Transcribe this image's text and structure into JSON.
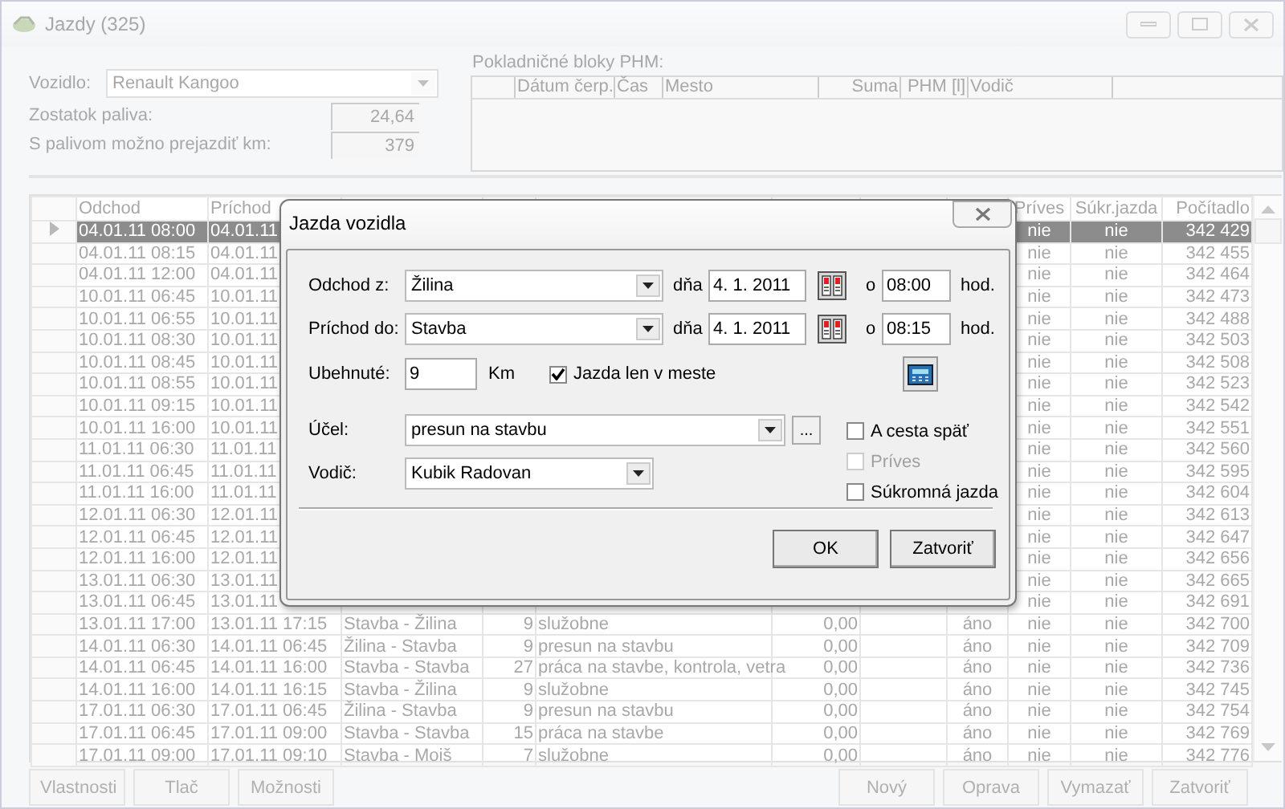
{
  "window": {
    "title": "Jazdy (325)",
    "disabled": true
  },
  "vehicle": {
    "label": "Vozidlo:",
    "value": "Renault Kangoo"
  },
  "fuel_left": {
    "label": "Zostatok paliva:",
    "value": "24,64"
  },
  "range": {
    "label": "S palivom možno prejazdiť km:",
    "value": "379"
  },
  "receipts": {
    "label": "Pokladničné bloky PHM:",
    "columns": [
      {
        "label": "Dátum čerp."
      },
      {
        "label": "Čas"
      },
      {
        "label": "Mesto"
      },
      {
        "label": "Suma"
      },
      {
        "label": "PHM [l]"
      },
      {
        "label": "Vodič"
      }
    ]
  },
  "table": {
    "left_columns": [
      "Odchod",
      "Príchod"
    ],
    "right_columns": [
      "Príves",
      "Súkr.jazda",
      "Počítadlo"
    ],
    "rows": [
      {
        "selected": true,
        "left_cells": [
          "04.01.11 08:00",
          "04.01.11"
        ],
        "right_cells": [
          "nie",
          "nie",
          "342 429"
        ]
      },
      {
        "selected": false,
        "left_cells": [
          "04.01.11 08:15",
          "04.01.11"
        ],
        "right_cells": [
          "nie",
          "nie",
          "342 455"
        ]
      },
      {
        "selected": false,
        "left_cells": [
          "04.01.11 12:00",
          "04.01.11"
        ],
        "right_cells": [
          "nie",
          "nie",
          "342 464"
        ]
      },
      {
        "selected": false,
        "left_cells": [
          "10.01.11 06:45",
          "10.01.11"
        ],
        "right_cells": [
          "nie",
          "nie",
          "342 473"
        ]
      },
      {
        "selected": false,
        "left_cells": [
          "10.01.11 06:55",
          "10.01.11"
        ],
        "right_cells": [
          "nie",
          "nie",
          "342 488"
        ]
      },
      {
        "selected": false,
        "left_cells": [
          "10.01.11 08:30",
          "10.01.11"
        ],
        "right_cells": [
          "nie",
          "nie",
          "342 503"
        ]
      },
      {
        "selected": false,
        "left_cells": [
          "10.01.11 08:45",
          "10.01.11"
        ],
        "right_cells": [
          "nie",
          "nie",
          "342 508"
        ]
      },
      {
        "selected": false,
        "left_cells": [
          "10.01.11 08:55",
          "10.01.11"
        ],
        "right_cells": [
          "nie",
          "nie",
          "342 523"
        ]
      },
      {
        "selected": false,
        "left_cells": [
          "10.01.11 09:15",
          "10.01.11"
        ],
        "right_cells": [
          "nie",
          "nie",
          "342 542"
        ]
      },
      {
        "selected": false,
        "left_cells": [
          "10.01.11 16:00",
          "10.01.11"
        ],
        "right_cells": [
          "nie",
          "nie",
          "342 551"
        ]
      },
      {
        "selected": false,
        "left_cells": [
          "11.01.11 06:30",
          "11.01.11"
        ],
        "right_cells": [
          "nie",
          "nie",
          "342 560"
        ]
      },
      {
        "selected": false,
        "left_cells": [
          "11.01.11 06:45",
          "11.01.11"
        ],
        "right_cells": [
          "nie",
          "nie",
          "342 595"
        ]
      },
      {
        "selected": false,
        "left_cells": [
          "11.01.11 16:00",
          "11.01.11"
        ],
        "right_cells": [
          "nie",
          "nie",
          "342 604"
        ]
      },
      {
        "selected": false,
        "left_cells": [
          "12.01.11 06:30",
          "12.01.11"
        ],
        "right_cells": [
          "nie",
          "nie",
          "342 613"
        ]
      },
      {
        "selected": false,
        "left_cells": [
          "12.01.11 06:45",
          "12.01.11"
        ],
        "right_cells": [
          "nie",
          "nie",
          "342 647"
        ]
      },
      {
        "selected": false,
        "left_cells": [
          "12.01.11 16:00",
          "12.01.11"
        ],
        "right_cells": [
          "nie",
          "nie",
          "342 656"
        ]
      },
      {
        "selected": false,
        "left_cells": [
          "13.01.11 06:30",
          "13.01.11"
        ],
        "right_cells": [
          "nie",
          "nie",
          "342 665"
        ]
      },
      {
        "selected": false,
        "left_cells": [
          "13.01.11 06:45",
          "13.01.11"
        ],
        "right_cells": [
          "nie",
          "nie",
          "342 691"
        ]
      },
      {
        "selected": false,
        "left_cells": [
          "13.01.11 17:00",
          "13.01.11 17:15",
          "Stavba - Žilina",
          "9",
          "služobne",
          "0,00"
        ],
        "right_cells": [
          "áno",
          "nie",
          "nie",
          "342 700"
        ]
      },
      {
        "selected": false,
        "left_cells": [
          "14.01.11 06:30",
          "14.01.11 06:45",
          "Žilina - Stavba",
          "9",
          "presun na stavbu",
          "0,00"
        ],
        "right_cells": [
          "áno",
          "nie",
          "nie",
          "342 709"
        ]
      },
      {
        "selected": false,
        "left_cells": [
          "14.01.11 06:45",
          "14.01.11 16:00",
          "Stavba - Stavba",
          "27",
          "práca na stavbe, kontrola, vetra",
          "0,00"
        ],
        "right_cells": [
          "áno",
          "nie",
          "nie",
          "342 736"
        ]
      },
      {
        "selected": false,
        "left_cells": [
          "14.01.11 16:00",
          "14.01.11 16:15",
          "Stavba - Žilina",
          "9",
          "služobne",
          "0,00"
        ],
        "right_cells": [
          "áno",
          "nie",
          "nie",
          "342 745"
        ]
      },
      {
        "selected": false,
        "left_cells": [
          "17.01.11 06:30",
          "17.01.11 06:45",
          "Žilina - Stavba",
          "9",
          "presun na stavbu",
          "0,00"
        ],
        "right_cells": [
          "áno",
          "nie",
          "nie",
          "342 754"
        ]
      },
      {
        "selected": false,
        "left_cells": [
          "17.01.11 06:45",
          "17.01.11 09:00",
          "Stavba - Stavba",
          "15",
          "práca na stavbe",
          "0,00"
        ],
        "right_cells": [
          "áno",
          "nie",
          "nie",
          "342 769"
        ]
      },
      {
        "selected": false,
        "left_cells": [
          "17.01.11 09:00",
          "17.01.11 09:10",
          "Stavba - Moiš",
          "7",
          "služobne",
          "0,00"
        ],
        "right_cells": [
          "áno",
          "nie",
          "nie",
          "342 776"
        ]
      }
    ]
  },
  "left_buttons": [
    "Vlastnosti",
    "Tlač",
    "Možnosti"
  ],
  "right_buttons": [
    "Nový",
    "Oprava",
    "Vymazať",
    "Zatvoriť"
  ],
  "dialog": {
    "title": "Jazda vozidla",
    "trips": [
      {
        "label": "Odchod z:",
        "place": "Žilina",
        "date_label": "dňa",
        "date": "4. 1. 2011",
        "time_label": "o",
        "time": "08:00",
        "unit": "hod."
      },
      {
        "label": "Príchod do:",
        "place": "Stavba",
        "date_label": "dňa",
        "date": "4. 1. 2011",
        "time_label": "o",
        "time": "08:15",
        "unit": "hod."
      }
    ],
    "distance": {
      "label": "Ubehnuté:",
      "value": "9",
      "unit": "Km"
    },
    "city_only": {
      "label": "Jazda len v meste",
      "checked": true
    },
    "purpose": {
      "label": "Účel:",
      "value": "presun na stavbu",
      "more": "..."
    },
    "driver": {
      "label": "Vodič:",
      "value": "Kubik Radovan"
    },
    "options": [
      {
        "label": "A cesta späť",
        "checked": false,
        "disabled": false
      },
      {
        "label": "Príves",
        "checked": false,
        "disabled": true
      },
      {
        "label": "Súkromná jazda",
        "checked": false,
        "disabled": false
      }
    ],
    "buttons": [
      "OK",
      "Zatvoriť"
    ]
  }
}
